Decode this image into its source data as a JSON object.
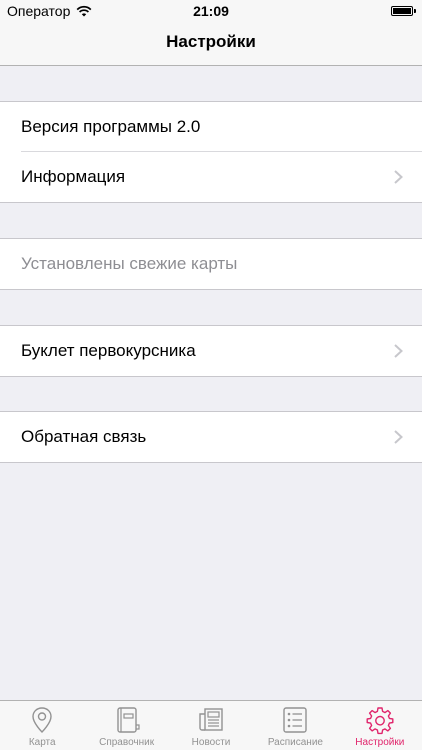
{
  "status_bar": {
    "carrier": "Оператор",
    "time": "21:09",
    "icons": [
      "wifi-icon",
      "battery-icon"
    ]
  },
  "nav": {
    "title": "Настройки"
  },
  "sections": [
    {
      "cells": [
        {
          "label": "Версия программы 2.0",
          "disclosure": false
        },
        {
          "label": "Информация",
          "disclosure": true
        }
      ]
    },
    {
      "cells": [
        {
          "label": "Установлены свежие карты",
          "disclosure": false,
          "disabled": true
        }
      ]
    },
    {
      "cells": [
        {
          "label": "Буклет первокурсника",
          "disclosure": true
        }
      ]
    },
    {
      "cells": [
        {
          "label": "Обратная связь",
          "disclosure": true
        }
      ]
    }
  ],
  "tabs": [
    {
      "label": "Карта",
      "icon": "map-pin-icon"
    },
    {
      "label": "Справочник",
      "icon": "book-icon"
    },
    {
      "label": "Новости",
      "icon": "newspaper-icon"
    },
    {
      "label": "Расписание",
      "icon": "list-icon"
    },
    {
      "label": "Настройки",
      "icon": "gear-icon",
      "active": true
    }
  ],
  "colors": {
    "accent": "#e0246b",
    "background": "#efeff4",
    "inactive": "#929292"
  }
}
